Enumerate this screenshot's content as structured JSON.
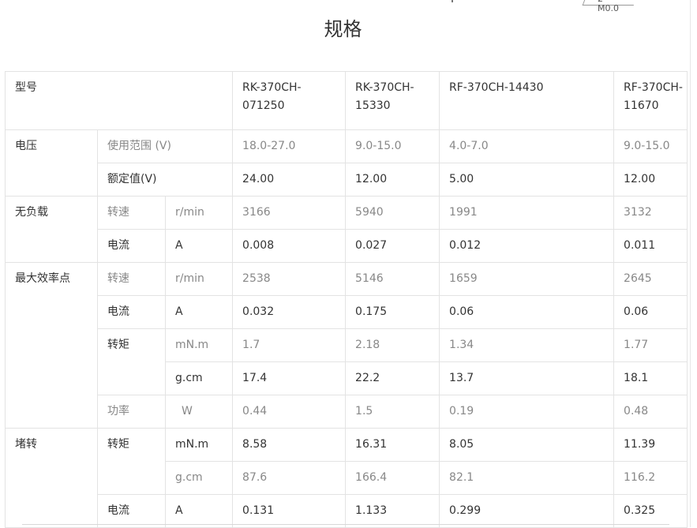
{
  "title": "规格",
  "top_fragment_text": "2 M0.0",
  "table": {
    "header": {
      "label": "型号",
      "models": [
        "RK-370CH-071250",
        "RK-370CH-15330",
        "RF-370CH-14430",
        "RF-370CH-11670"
      ],
      "model_lines": [
        [
          "RK-370CH-",
          "071250"
        ],
        [
          "RK-370CH-",
          "15330"
        ],
        [
          "RF-370CH-14430"
        ],
        [
          "RF-370CH-",
          "11670"
        ]
      ]
    },
    "voltage": {
      "group": "电压",
      "range": {
        "label": "使用范围 (V)",
        "values": [
          "18.0-27.0",
          "9.0-15.0",
          "4.0-7.0",
          "9.0-15.0"
        ]
      },
      "rated": {
        "label": "额定值(V)",
        "values": [
          "24.00",
          "12.00",
          "5.00",
          "12.00"
        ]
      }
    },
    "no_load": {
      "group": "无负载",
      "speed": {
        "label": "转速",
        "unit": "r/min",
        "values": [
          "3166",
          "5940",
          "1991",
          "3132"
        ]
      },
      "current": {
        "label": "电流",
        "unit": "A",
        "values": [
          "0.008",
          "0.027",
          "0.012",
          "0.011"
        ]
      }
    },
    "max_efficiency": {
      "group": "最大效率点",
      "speed": {
        "label": "转速",
        "unit": "r/min",
        "values": [
          "2538",
          "5146",
          "1659",
          "2645"
        ]
      },
      "current": {
        "label": "电流",
        "unit": "A",
        "values": [
          "0.032",
          "0.175",
          "0.06",
          "0.06"
        ]
      },
      "torque": {
        "label": "转矩",
        "unit_mn": "mN.m",
        "values_mn": [
          "1.7",
          "2.18",
          "1.34",
          "1.77"
        ],
        "unit_g": "g.cm",
        "values_g": [
          "17.4",
          "22.2",
          "13.7",
          "18.1"
        ]
      },
      "power": {
        "label": "功率",
        "unit": "W",
        "values": [
          "0.44",
          "1.5",
          "0.19",
          "0.48"
        ]
      }
    },
    "stall": {
      "group": "堵转",
      "torque": {
        "label": "转矩",
        "unit_mn": "mN.m",
        "values_mn": [
          "8.58",
          "16.31",
          "8.05",
          "11.39"
        ],
        "unit_g": "g.cm",
        "values_g": [
          "87.6",
          "166.4",
          "82.1",
          "116.2"
        ]
      },
      "current": {
        "label": "电流",
        "unit": "A",
        "values": [
          "0.131",
          "1.133",
          "0.299",
          "0.325"
        ]
      }
    }
  }
}
